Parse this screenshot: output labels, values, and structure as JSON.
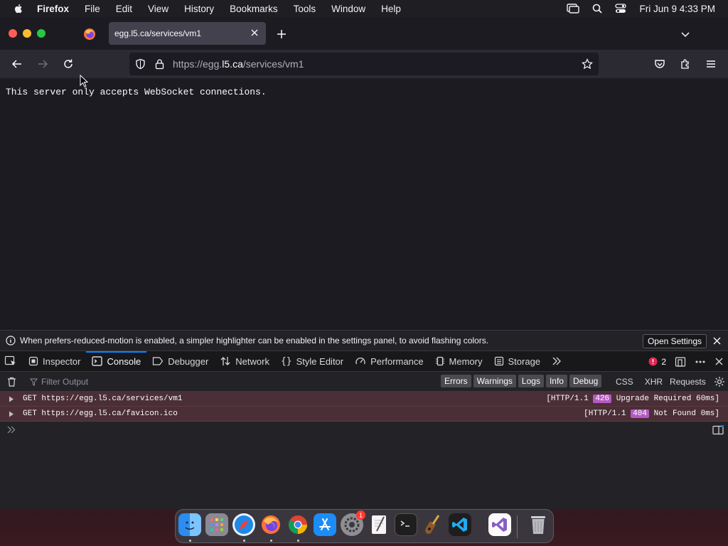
{
  "menubar": {
    "app_name": "Firefox",
    "items": [
      "File",
      "Edit",
      "View",
      "History",
      "Bookmarks",
      "Tools",
      "Window",
      "Help"
    ],
    "clock": "Fri Jun 9  4:33 PM"
  },
  "browser": {
    "tab_title": "egg.l5.ca/services/vm1",
    "url_prefix": "https://egg.",
    "url_domain": "l5.ca",
    "url_path": "/services/vm1",
    "page_text": "This server only accepts WebSocket connections."
  },
  "devtools": {
    "notice_text": "When prefers-reduced-motion is enabled, a simpler highlighter can be enabled in the settings panel, to avoid flashing colors.",
    "open_settings_label": "Open Settings",
    "tabs": {
      "inspector": "Inspector",
      "console": "Console",
      "debugger": "Debugger",
      "network": "Network",
      "style_editor": "Style Editor",
      "performance": "Performance",
      "memory": "Memory",
      "storage": "Storage"
    },
    "error_count": "2",
    "filter_placeholder": "Filter Output",
    "levels": {
      "errors": "Errors",
      "warnings": "Warnings",
      "logs": "Logs",
      "info": "Info",
      "debug": "Debug"
    },
    "types": {
      "css": "CSS",
      "xhr": "XHR",
      "requests": "Requests"
    },
    "messages": [
      {
        "request": "GET https://egg.l5.ca/services/vm1",
        "status_prefix": "[HTTP/1.1",
        "code": "426",
        "status_suffix": "Upgrade Required 60ms]"
      },
      {
        "request": "GET https://egg.l5.ca/favicon.ico",
        "status_prefix": "[HTTP/1.1",
        "code": "404",
        "status_suffix": "Not Found 0ms]"
      }
    ]
  },
  "dock": {
    "settings_badge": "1"
  },
  "colors": {
    "accent": "#0a84ff",
    "error_row": "#4b2f36",
    "status_code": "#b45ac2",
    "error_icon": "#e22850"
  }
}
